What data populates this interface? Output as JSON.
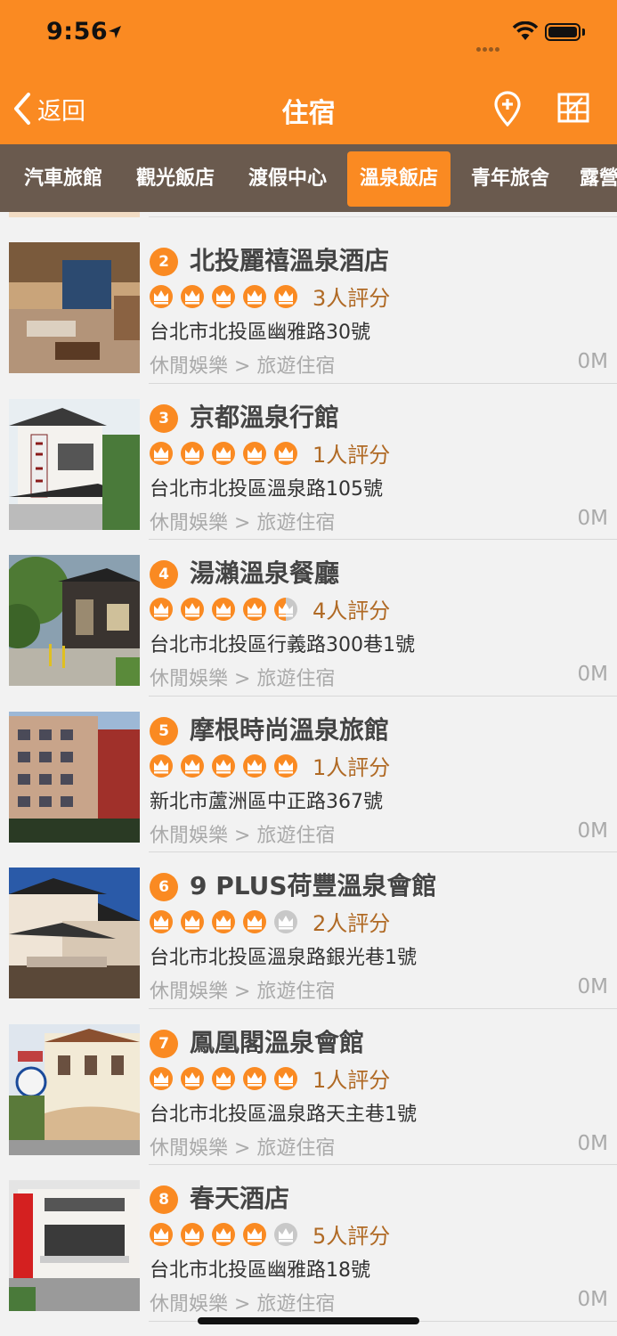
{
  "status": {
    "time": "9:56"
  },
  "nav": {
    "back_label": "返回",
    "title": "住宿",
    "map_icon": "map-pin-icon",
    "grid_icon": "map-grid-icon"
  },
  "tabs": [
    {
      "label": "汽車旅館",
      "active": false
    },
    {
      "label": "觀光飯店",
      "active": false
    },
    {
      "label": "渡假中心",
      "active": false
    },
    {
      "label": "溫泉飯店",
      "active": true
    },
    {
      "label": "青年旅舍",
      "active": false
    },
    {
      "label": "露營",
      "active": false
    }
  ],
  "colors": {
    "accent": "#fa8a22",
    "tab_bar": "#6a5a4e",
    "rating_text": "#b06a25",
    "crown_empty": "#c8c8c8"
  },
  "items": [
    {
      "rank": "2",
      "name": "北投麗禧溫泉酒店",
      "stars": 5,
      "rating": "3人評分",
      "address": "台北市北投區幽雅路30號",
      "category": "休閒娛樂 > 旅遊住宿",
      "distance": "0M"
    },
    {
      "rank": "3",
      "name": "京都溫泉行館",
      "stars": 5,
      "rating": "1人評分",
      "address": "台北市北投區溫泉路105號",
      "category": "休閒娛樂 > 旅遊住宿",
      "distance": "0M"
    },
    {
      "rank": "4",
      "name": "湯瀨溫泉餐廳",
      "stars": 4.5,
      "rating": "4人評分",
      "address": "台北市北投區行義路300巷1號",
      "category": "休閒娛樂 > 旅遊住宿",
      "distance": "0M"
    },
    {
      "rank": "5",
      "name": "摩根時尚溫泉旅館",
      "stars": 5,
      "rating": "1人評分",
      "address": "新北市蘆洲區中正路367號",
      "category": "休閒娛樂 > 旅遊住宿",
      "distance": "0M"
    },
    {
      "rank": "6",
      "name": "9 PLUS荷豐溫泉會館",
      "stars": 4,
      "rating": "2人評分",
      "address": "台北市北投區溫泉路銀光巷1號",
      "category": "休閒娛樂 > 旅遊住宿",
      "distance": "0M"
    },
    {
      "rank": "7",
      "name": "鳳凰閣溫泉會館",
      "stars": 5,
      "rating": "1人評分",
      "address": "台北市北投區溫泉路天主巷1號",
      "category": "休閒娛樂 > 旅遊住宿",
      "distance": "0M"
    },
    {
      "rank": "8",
      "name": "春天酒店",
      "stars": 4,
      "rating": "5人評分",
      "address": "台北市北投區幽雅路18號",
      "category": "休閒娛樂 > 旅遊住宿",
      "distance": "0M"
    }
  ]
}
